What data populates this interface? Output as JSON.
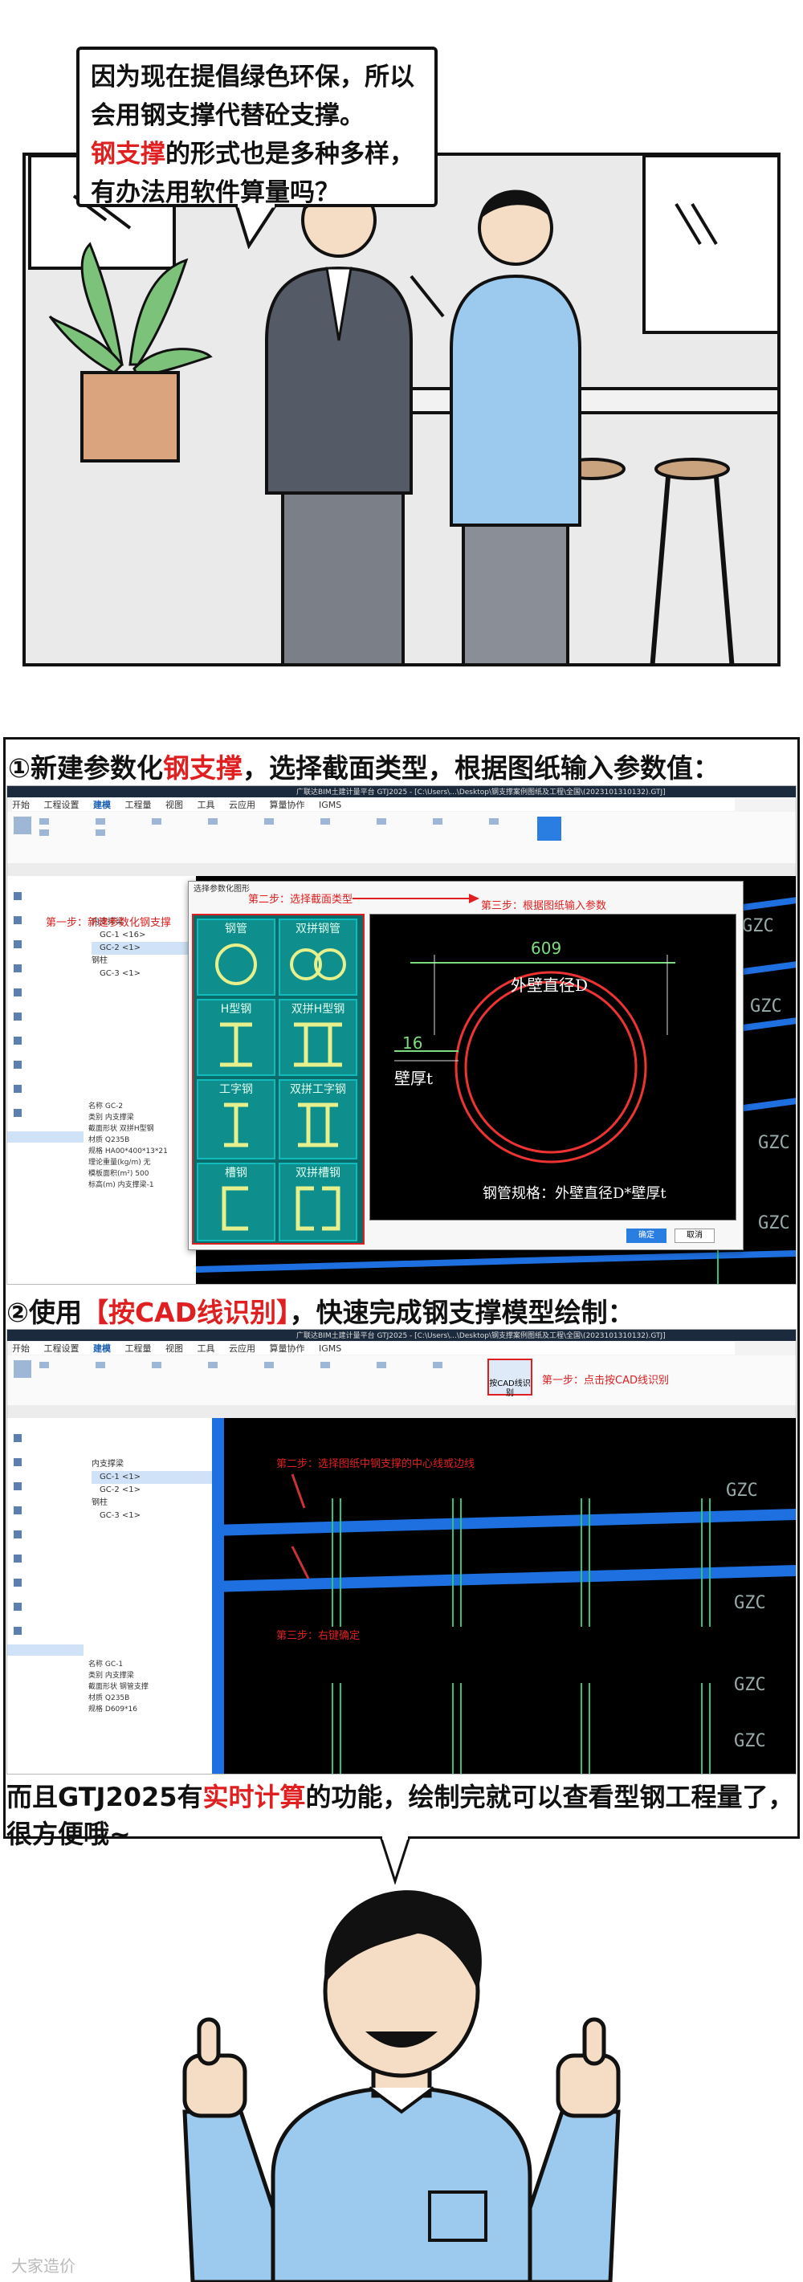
{
  "panel1": {
    "speech_part1": "因为现在提倡绿色环保，所以会用钢支撑代替砼支撑。",
    "speech_highlight": "钢支撑",
    "speech_part2": "的形式也是多种多样，有办法用软件算量吗？"
  },
  "section1": {
    "title_prefix": "①新建参数化",
    "title_highlight": "钢支撑",
    "title_suffix": "，选择截面类型，根据图纸输入参数值：",
    "app_title": "广联达BIM土建计量平台 GTJ2025 - [C:\\Users\\...\\Desktop\\钢支撑案例图纸及工程\\全国\\(2023101310132).GTJ]",
    "menu": [
      "开始",
      "工程设置",
      "建模",
      "工程量",
      "视图",
      "工具",
      "云应用",
      "算量协作",
      "IGMS"
    ],
    "dialog_title": "选择参数化图形",
    "step1": "第一步：新建参数化钢支撑",
    "step2": "第二步：选择截面类型",
    "step3": "第三步：根据图纸输入参数",
    "shapes": [
      "钢管",
      "双拼钢管",
      "H型钢",
      "双拼H型钢",
      "工字钢",
      "双拼工字钢",
      "槽钢",
      "双拼槽钢"
    ],
    "dim_outer_value": "609",
    "dim_outer_label": "外壁直径D",
    "dim_wall_value": "16",
    "dim_wall_label": "壁厚t",
    "spec_label": "钢管规格：外壁直径D*壁厚t",
    "ok_button": "确定",
    "cancel_button": "取消",
    "tree_items": [
      "内支撑梁",
      "GC-1 <16>",
      "GC-2 <1>",
      "钢柱",
      "GC-3 <1>"
    ],
    "prop_rows": [
      [
        "名称",
        "GC-2"
      ],
      [
        "类别",
        "内支撑梁"
      ],
      [
        "截面形状",
        "双拼H型钢"
      ],
      [
        "材质",
        "Q235B"
      ],
      [
        "规格",
        "HA00*400*13*21"
      ],
      [
        "理论重量(kg/m)",
        "无"
      ],
      [
        "模板面积(m²)",
        "500"
      ],
      [
        "标高(m)",
        "内支撑梁-1"
      ]
    ],
    "gzc": [
      "GZC",
      "GZC",
      "GZC",
      "GZC"
    ]
  },
  "section2": {
    "title_prefix": "②使用",
    "title_highlight": "【按CAD线识别】",
    "title_suffix": "，快速完成钢支撑模型绘制：",
    "app_title": "广联达BIM土建计量平台 GTJ2025 - [C:\\Users\\...\\Desktop\\钢支撑案例图纸及工程\\全国\\(2023101310132).GTJ]",
    "menu": [
      "开始",
      "工程设置",
      "建模",
      "工程量",
      "视图",
      "工具",
      "云应用",
      "算量协作",
      "IGMS"
    ],
    "button_label": "按CAD线识别",
    "step1": "第一步：点击按CAD线识别",
    "step2": "第二步：选择图纸中钢支撑的中心线或边线",
    "step3": "第三步：右键确定",
    "tree_items": [
      "内支撑梁",
      "GC-1 <1>",
      "GC-2 <1>",
      "钢柱",
      "GC-3 <1>"
    ],
    "prop_rows": [
      [
        "名称",
        "GC-1"
      ],
      [
        "类别",
        "内支撑梁"
      ],
      [
        "截面形状",
        "钢管支撑"
      ],
      [
        "材质",
        "Q235B"
      ],
      [
        "规格",
        "D609*16"
      ]
    ],
    "gzc": [
      "GZC",
      "GZC",
      "GZC",
      "GZC"
    ]
  },
  "section3": {
    "text_prefix": "而且GTJ2025有",
    "text_highlight": "实时计算",
    "text_suffix": "的功能，绘制完就可以查看型钢工程量了，很方便哦~"
  },
  "watermark": "大家造价",
  "colors": {
    "accent_red": "#e02020",
    "teal": "#0f8e8e",
    "shirt_blue": "#9cc9ee",
    "cad_blue": "#1e6fe0"
  }
}
